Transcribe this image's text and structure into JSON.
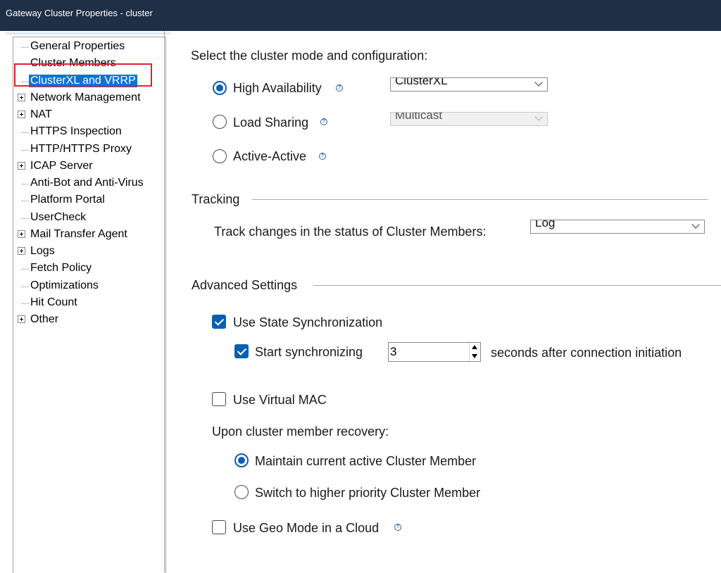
{
  "window": {
    "title": "Gateway Cluster Properties - cluster"
  },
  "tree": {
    "items": [
      {
        "label": "General Properties",
        "expandable": false,
        "selected": false
      },
      {
        "label": "Cluster Members",
        "expandable": false,
        "selected": false
      },
      {
        "label": "ClusterXL and VRRP",
        "expandable": false,
        "selected": true
      },
      {
        "label": "Network Management",
        "expandable": true,
        "selected": false
      },
      {
        "label": "NAT",
        "expandable": true,
        "selected": false
      },
      {
        "label": "HTTPS Inspection",
        "expandable": false,
        "selected": false
      },
      {
        "label": "HTTP/HTTPS Proxy",
        "expandable": false,
        "selected": false
      },
      {
        "label": "ICAP Server",
        "expandable": true,
        "selected": false
      },
      {
        "label": "Anti-Bot and Anti-Virus",
        "expandable": false,
        "selected": false
      },
      {
        "label": "Platform Portal",
        "expandable": false,
        "selected": false
      },
      {
        "label": "UserCheck",
        "expandable": false,
        "selected": false
      },
      {
        "label": "Mail Transfer Agent",
        "expandable": true,
        "selected": false
      },
      {
        "label": "Logs",
        "expandable": true,
        "selected": false
      },
      {
        "label": "Fetch Policy",
        "expandable": false,
        "selected": false
      },
      {
        "label": "Optimizations",
        "expandable": false,
        "selected": false
      },
      {
        "label": "Hit Count",
        "expandable": false,
        "selected": false
      },
      {
        "label": "Other",
        "expandable": true,
        "selected": false
      }
    ]
  },
  "mode": {
    "heading": "Select the cluster mode and configuration:",
    "ha_label": "High Availability",
    "ha_selected": true,
    "ha_select_value": "ClusterXL",
    "ls_label": "Load Sharing",
    "ls_select_value": "Multicast",
    "aa_label": "Active-Active"
  },
  "tracking": {
    "heading": "Tracking",
    "label": "Track changes in the status of Cluster Members:",
    "select_value": "Log"
  },
  "advanced": {
    "heading": "Advanced Settings",
    "state_sync_label": "Use State Synchronization",
    "start_sync_label": "Start synchronizing",
    "start_sync_value": "3",
    "seconds_label": "seconds after connection initiation",
    "virtual_mac_label": "Use Virtual MAC",
    "recovery_label": "Upon cluster member recovery:",
    "maintain_label": "Maintain current active Cluster Member",
    "switch_label": "Switch to higher priority Cluster Member",
    "geo_label": "Use Geo Mode in a Cloud"
  },
  "colors": {
    "accent": "#0a5fb3",
    "selection": "#0a74d9",
    "titlebar": "#1f2f45",
    "highlight_border": "#e0212b"
  },
  "icons": {
    "help": "help-icon",
    "expand": "plus-box-icon"
  }
}
